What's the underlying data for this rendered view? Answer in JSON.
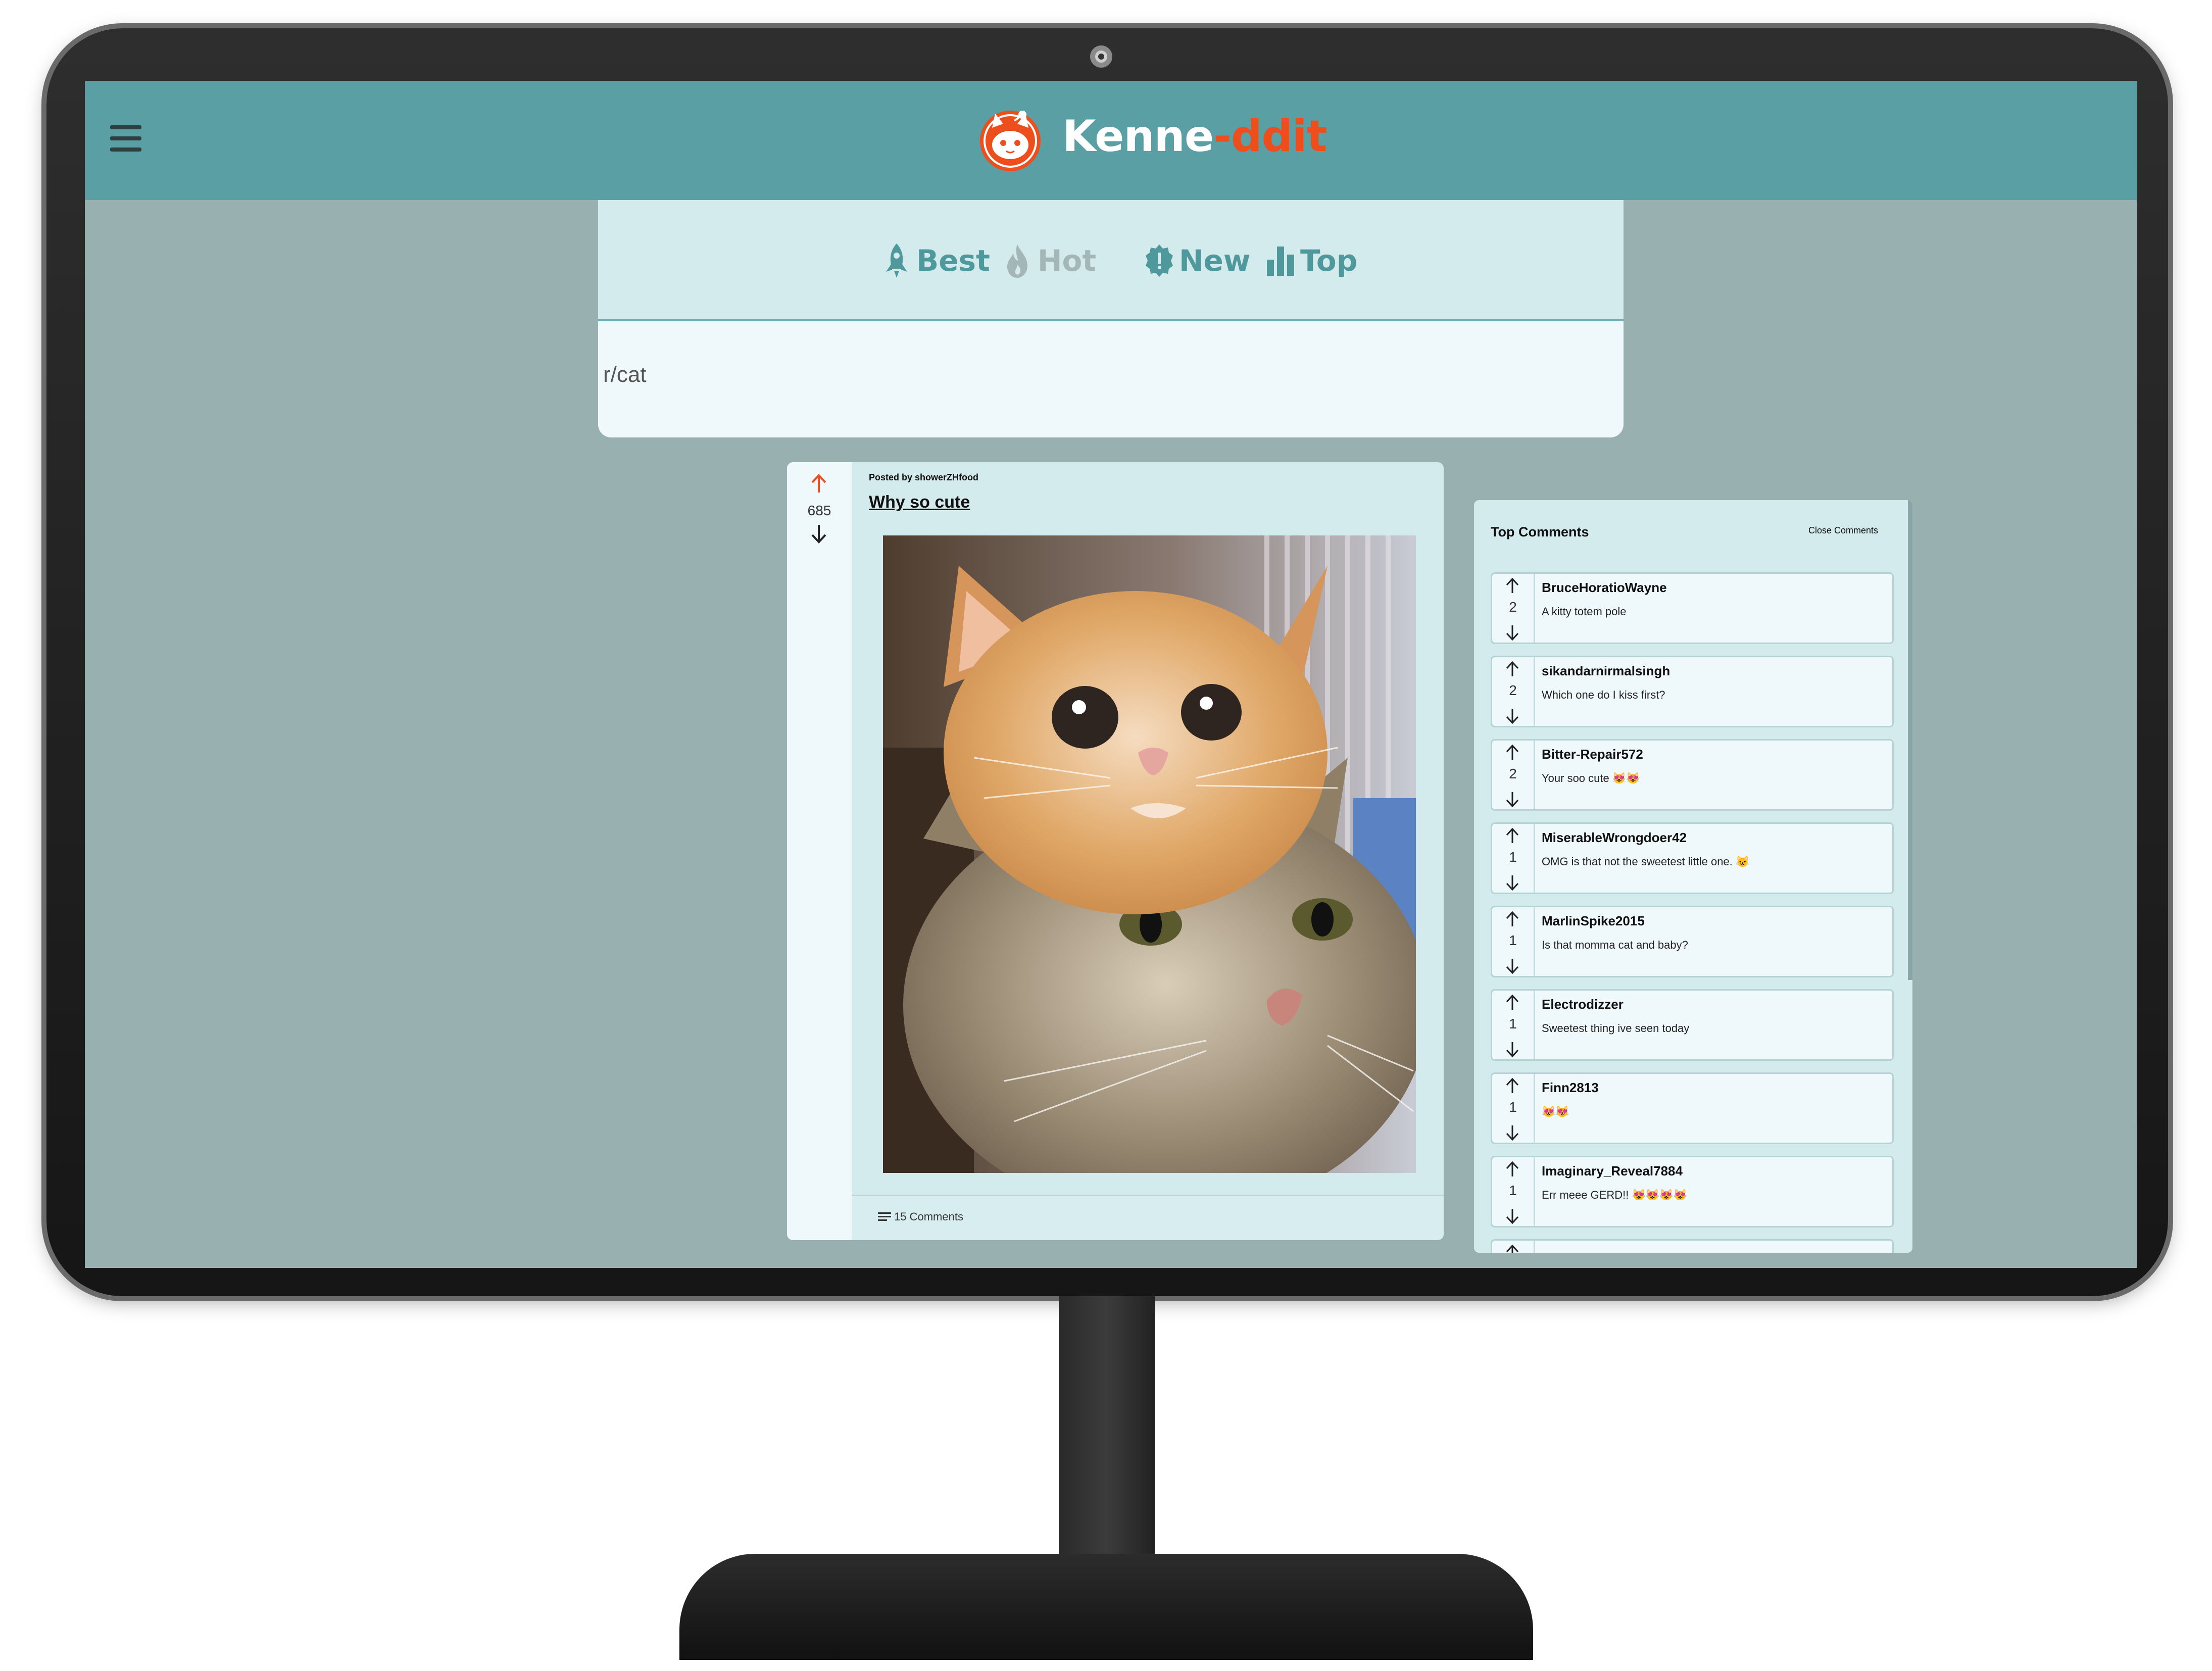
{
  "app": {
    "brand_main": "Kenne",
    "brand_accent": "-ddit"
  },
  "filters": [
    {
      "label": "Best",
      "icon": "rocket-icon"
    },
    {
      "label": "Hot",
      "icon": "flame-icon"
    },
    {
      "label": "New",
      "icon": "new-badge-icon"
    },
    {
      "label": "Top",
      "icon": "bar-chart-icon"
    }
  ],
  "search": {
    "placeholder": "r/cat"
  },
  "post": {
    "posted_by": "Posted by showerZHfood",
    "title": "Why so cute",
    "score": "685",
    "comments_label": "15 Comments"
  },
  "comments_panel": {
    "title": "Top Comments",
    "close_label": "Close Comments",
    "items": [
      {
        "author": "BruceHoratioWayne",
        "text": "A kitty totem pole",
        "score": "2"
      },
      {
        "author": "sikandarnirmalsingh",
        "text": "Which one do I kiss first?",
        "score": "2"
      },
      {
        "author": "Bitter-Repair572",
        "text": "Your soo cute 😻😻",
        "score": "2"
      },
      {
        "author": "MiserableWrongdoer42",
        "text": "OMG is that not the sweetest little one. 😺",
        "score": "1"
      },
      {
        "author": "MarlinSpike2015",
        "text": "Is that momma cat and baby?",
        "score": "1"
      },
      {
        "author": "Electrodizzer",
        "text": "Sweetest thing ive seen today",
        "score": "1"
      },
      {
        "author": "Finn2813",
        "text": "😻😻",
        "score": "1"
      },
      {
        "author": "Imaginary_Reveal7884",
        "text": "Err meee GERD!! 😻😻😻😻",
        "score": "1"
      }
    ]
  },
  "colors": {
    "header": "#599fa3",
    "background": "#99b0b1",
    "card": "#d3ebed",
    "accent": "#ee4e1c",
    "upvote": "#ee4e1c"
  }
}
